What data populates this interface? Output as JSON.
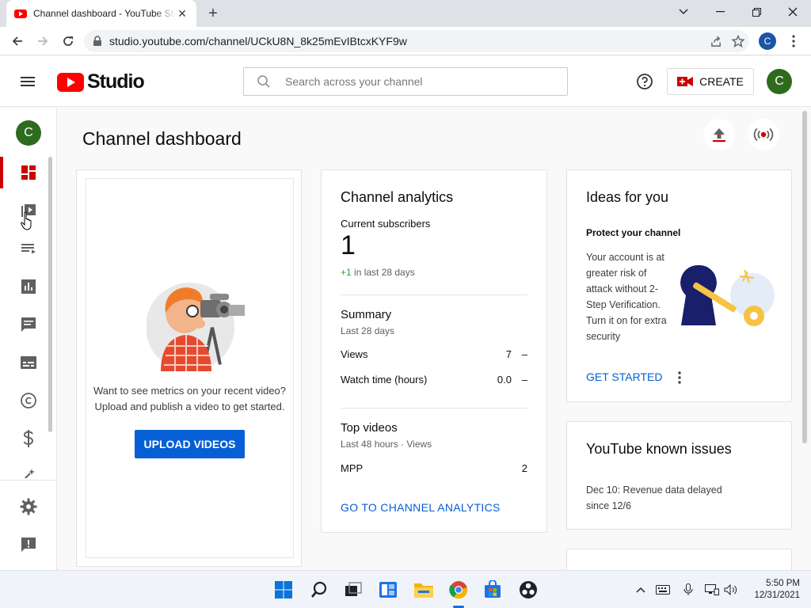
{
  "browser": {
    "tab_title": "Channel dashboard - YouTube Studio",
    "url": "studio.youtube.com/channel/UCkU8N_8k25mEvIBtcxKYF9w",
    "profile_initial": "C"
  },
  "header": {
    "logo_text": "Studio",
    "search_placeholder": "Search across your channel",
    "create_label": "CREATE",
    "avatar_initial": "C"
  },
  "sidebar": {
    "avatar_initial": "C",
    "items": [
      {
        "name": "dashboard",
        "icon": "dashboard-icon",
        "active": true
      },
      {
        "name": "content",
        "icon": "video-library-icon"
      },
      {
        "name": "playlists",
        "icon": "playlist-icon"
      },
      {
        "name": "analytics",
        "icon": "analytics-icon"
      },
      {
        "name": "comments",
        "icon": "comments-icon"
      },
      {
        "name": "subtitles",
        "icon": "subtitles-icon"
      },
      {
        "name": "copyright",
        "icon": "copyright-icon"
      },
      {
        "name": "monetization",
        "icon": "dollar-icon"
      },
      {
        "name": "customization",
        "icon": "magic-wand-icon"
      },
      {
        "name": "settings",
        "icon": "gear-icon"
      },
      {
        "name": "feedback",
        "icon": "feedback-icon"
      }
    ]
  },
  "main": {
    "title": "Channel dashboard",
    "upload_card": {
      "text_line1": "Want to see metrics on your recent video?",
      "text_line2": "Upload and publish a video to get started.",
      "button": "UPLOAD VIDEOS"
    },
    "analytics": {
      "title": "Channel analytics",
      "subscribers_label": "Current subscribers",
      "subscribers_value": "1",
      "subscribers_delta": "+1 in last 28 days",
      "summary_title": "Summary",
      "summary_period": "Last 28 days",
      "rows": [
        {
          "label": "Views",
          "value": "7",
          "trend": "–"
        },
        {
          "label": "Watch time (hours)",
          "value": "0.0",
          "trend": "–"
        }
      ],
      "top_title": "Top videos",
      "top_period": "Last 48 hours · Views",
      "top_rows": [
        {
          "label": "MPP",
          "value": "2"
        }
      ],
      "link": "GO TO CHANNEL ANALYTICS"
    },
    "ideas": {
      "title": "Ideas for you",
      "subtitle": "Protect your channel",
      "body": "Your account is at greater risk of attack without 2-Step Verification. Turn it on for extra security",
      "link": "GET STARTED"
    },
    "issues": {
      "title": "YouTube known issues",
      "body": "Dec 10: Revenue data delayed since 12/6"
    }
  },
  "taskbar": {
    "time": "5:50 PM",
    "date": "12/31/2021"
  },
  "colors": {
    "brand_red": "#ff0000",
    "link_blue": "#065fd4",
    "avatar_green": "#2e6b1f",
    "active_red": "#cc0000"
  }
}
